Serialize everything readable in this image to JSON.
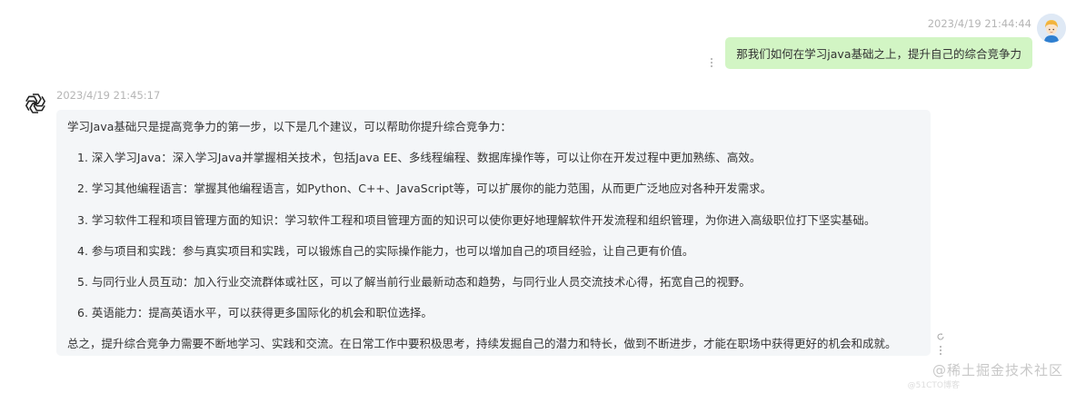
{
  "user_message": {
    "timestamp": "2023/4/19 21:44:44",
    "text": "那我们如何在学习java基础之上，提升自己的综合竞争力"
  },
  "bot_message": {
    "timestamp": "2023/4/19 21:45:17",
    "lines": [
      "学习Java基础只是提高竞争力的第一步，以下是几个建议，可以帮助你提升综合竞争力：",
      "1. 深入学习Java：深入学习Java并掌握相关技术，包括Java EE、多线程编程、数据库操作等，可以让你在开发过程中更加熟练、高效。",
      "2. 学习其他编程语言：掌握其他编程语言，如Python、C++、JavaScript等，可以扩展你的能力范围，从而更广泛地应对各种开发需求。",
      "3. 学习软件工程和项目管理方面的知识：学习软件工程和项目管理方面的知识可以使你更好地理解软件开发流程和组织管理，为你进入高级职位打下坚实基础。",
      "4. 参与项目和实践：参与真实项目和实践，可以锻炼自己的实际操作能力，也可以增加自己的项目经验，让自己更有价值。",
      "5. 与同行业人员互动：加入行业交流群体或社区，可以了解当前行业最新动态和趋势，与同行业人员交流技术心得，拓宽自己的视野。",
      "6. 英语能力：提高英语水平，可以获得更多国际化的机会和职位选择。",
      "总之，提升综合竞争力需要不断地学习、实践和交流。在日常工作中要积极思考，持续发掘自己的潜力和特长，做到不断进步，才能在职场中获得更好的机会和成就。"
    ]
  },
  "watermark": {
    "text": "@稀土掘金技术社区",
    "sub": "@51CTO博客"
  },
  "icons": {
    "user_avatar": "cartoon-avatar-icon",
    "bot_avatar": "openai-logo-icon",
    "message_menu": "more-vertical-icon",
    "regenerate": "refresh-icon"
  },
  "colors": {
    "user_bubble": "#d2f5c4",
    "bot_bubble": "#f4f6f8",
    "timestamp": "#b5b5b5",
    "text": "#333333"
  }
}
